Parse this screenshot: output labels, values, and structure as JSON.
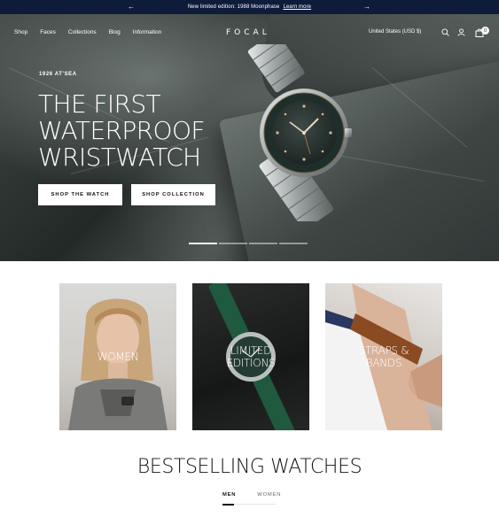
{
  "announcement": {
    "message": "New limited edition: 1988 Moonphase",
    "link_label": "Learn more",
    "prev_icon": "arrow-left-icon",
    "next_icon": "arrow-right-icon"
  },
  "nav": {
    "items": [
      "Shop",
      "Faces",
      "Collections",
      "Blog",
      "Information"
    ],
    "logo": "FOCAL",
    "currency": "United States (USD $)",
    "cart_count": "0",
    "icons": [
      "search-icon",
      "account-icon",
      "cart-icon"
    ]
  },
  "hero": {
    "eyebrow": "1926 AT'SEA",
    "headline_lines": [
      "THE FIRST",
      "WATERPROOF",
      "WRISTWATCH"
    ],
    "buttons": [
      "SHOP THE WATCH",
      "SHOP COLLECTION"
    ],
    "slide_count": 4,
    "active_slide": 1
  },
  "categories": [
    {
      "label": "WOMEN"
    },
    {
      "label": "LIMITED\nEDITIONS"
    },
    {
      "label": "STRAPS &\nBANDS"
    }
  ],
  "bestselling": {
    "title": "BESTSELLING WATCHES",
    "tabs": [
      "MEN",
      "WOMEN"
    ],
    "active_tab": "MEN"
  },
  "colors": {
    "announcement_bg": "#0f1b3a",
    "text_dark": "#111111",
    "white": "#ffffff"
  }
}
